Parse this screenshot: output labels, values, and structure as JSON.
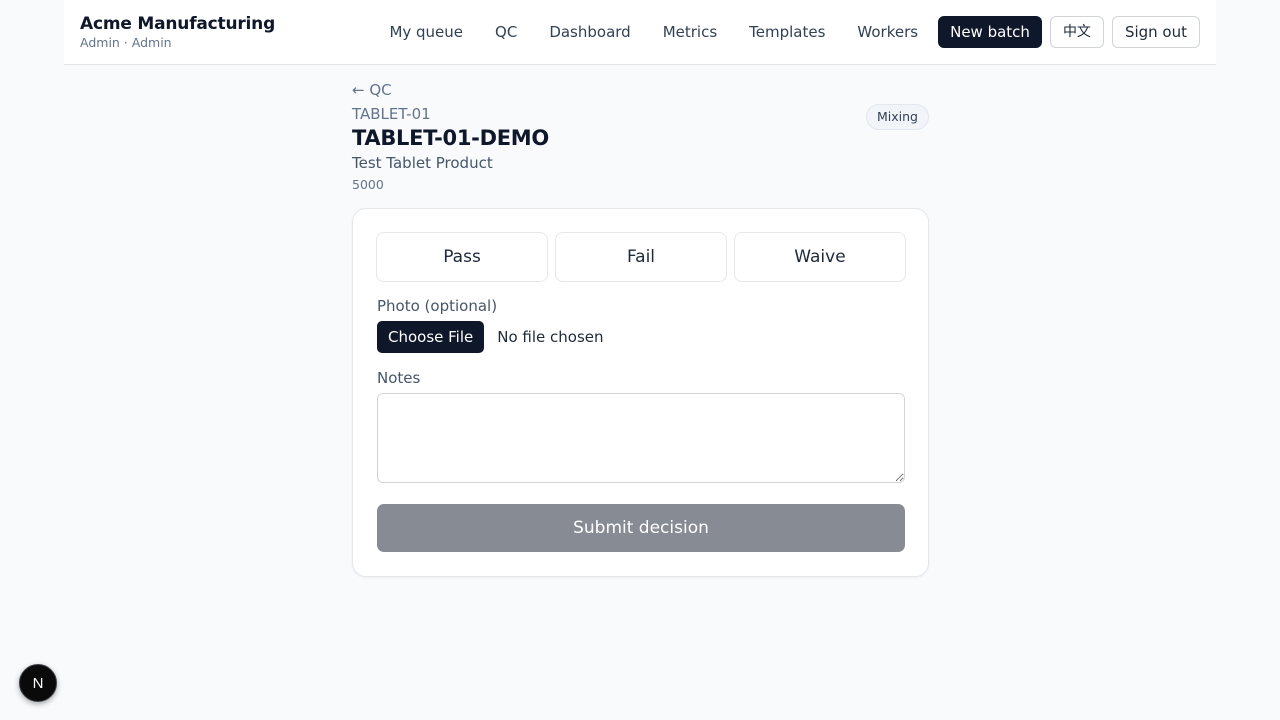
{
  "header": {
    "brand_title": "Acme Manufacturing",
    "brand_subtitle": "Admin · Admin",
    "nav": [
      "My queue",
      "QC",
      "Dashboard",
      "Metrics",
      "Templates",
      "Workers"
    ],
    "new_batch_label": "New batch",
    "language_label": "中文",
    "sign_out_label": "Sign out"
  },
  "batch": {
    "back_label": "← QC",
    "code": "TABLET-01",
    "title": "TABLET-01-DEMO",
    "product": "Test Tablet Product",
    "quantity": "5000",
    "stage": "Mixing"
  },
  "form": {
    "decisions": [
      "Pass",
      "Fail",
      "Waive"
    ],
    "photo_label": "Photo (optional)",
    "choose_file_label": "Choose File",
    "file_status": "No file chosen",
    "notes_label": "Notes",
    "notes_value": "",
    "submit_label": "Submit decision"
  },
  "dev_badge": {
    "letter": "N"
  },
  "colors": {
    "primary": "#0f172a",
    "submit_disabled": "#878b94",
    "background": "#f8fafc"
  }
}
